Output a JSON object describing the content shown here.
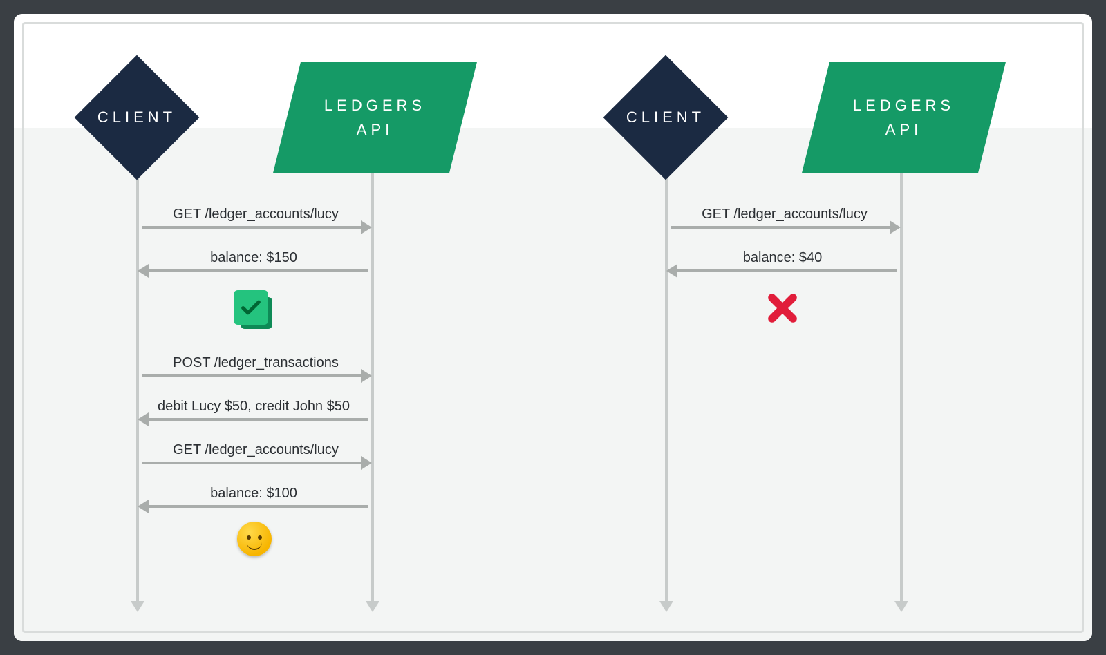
{
  "participants": {
    "client": "CLIENT",
    "ledgers_line1": "LEDGERS",
    "ledgers_line2": "API"
  },
  "left": {
    "m1": "GET /ledger_accounts/lucy",
    "m2": "balance: $150",
    "m3": "POST /ledger_transactions",
    "m4": "debit Lucy $50, credit John $50",
    "m5": "GET /ledger_accounts/lucy",
    "m6": "balance: $100"
  },
  "right": {
    "m1": "GET /ledger_accounts/lucy",
    "m2": "balance: $40"
  },
  "icons": {
    "check": "check-icon",
    "cross": "cross-icon",
    "smiley": "smiley-icon"
  }
}
